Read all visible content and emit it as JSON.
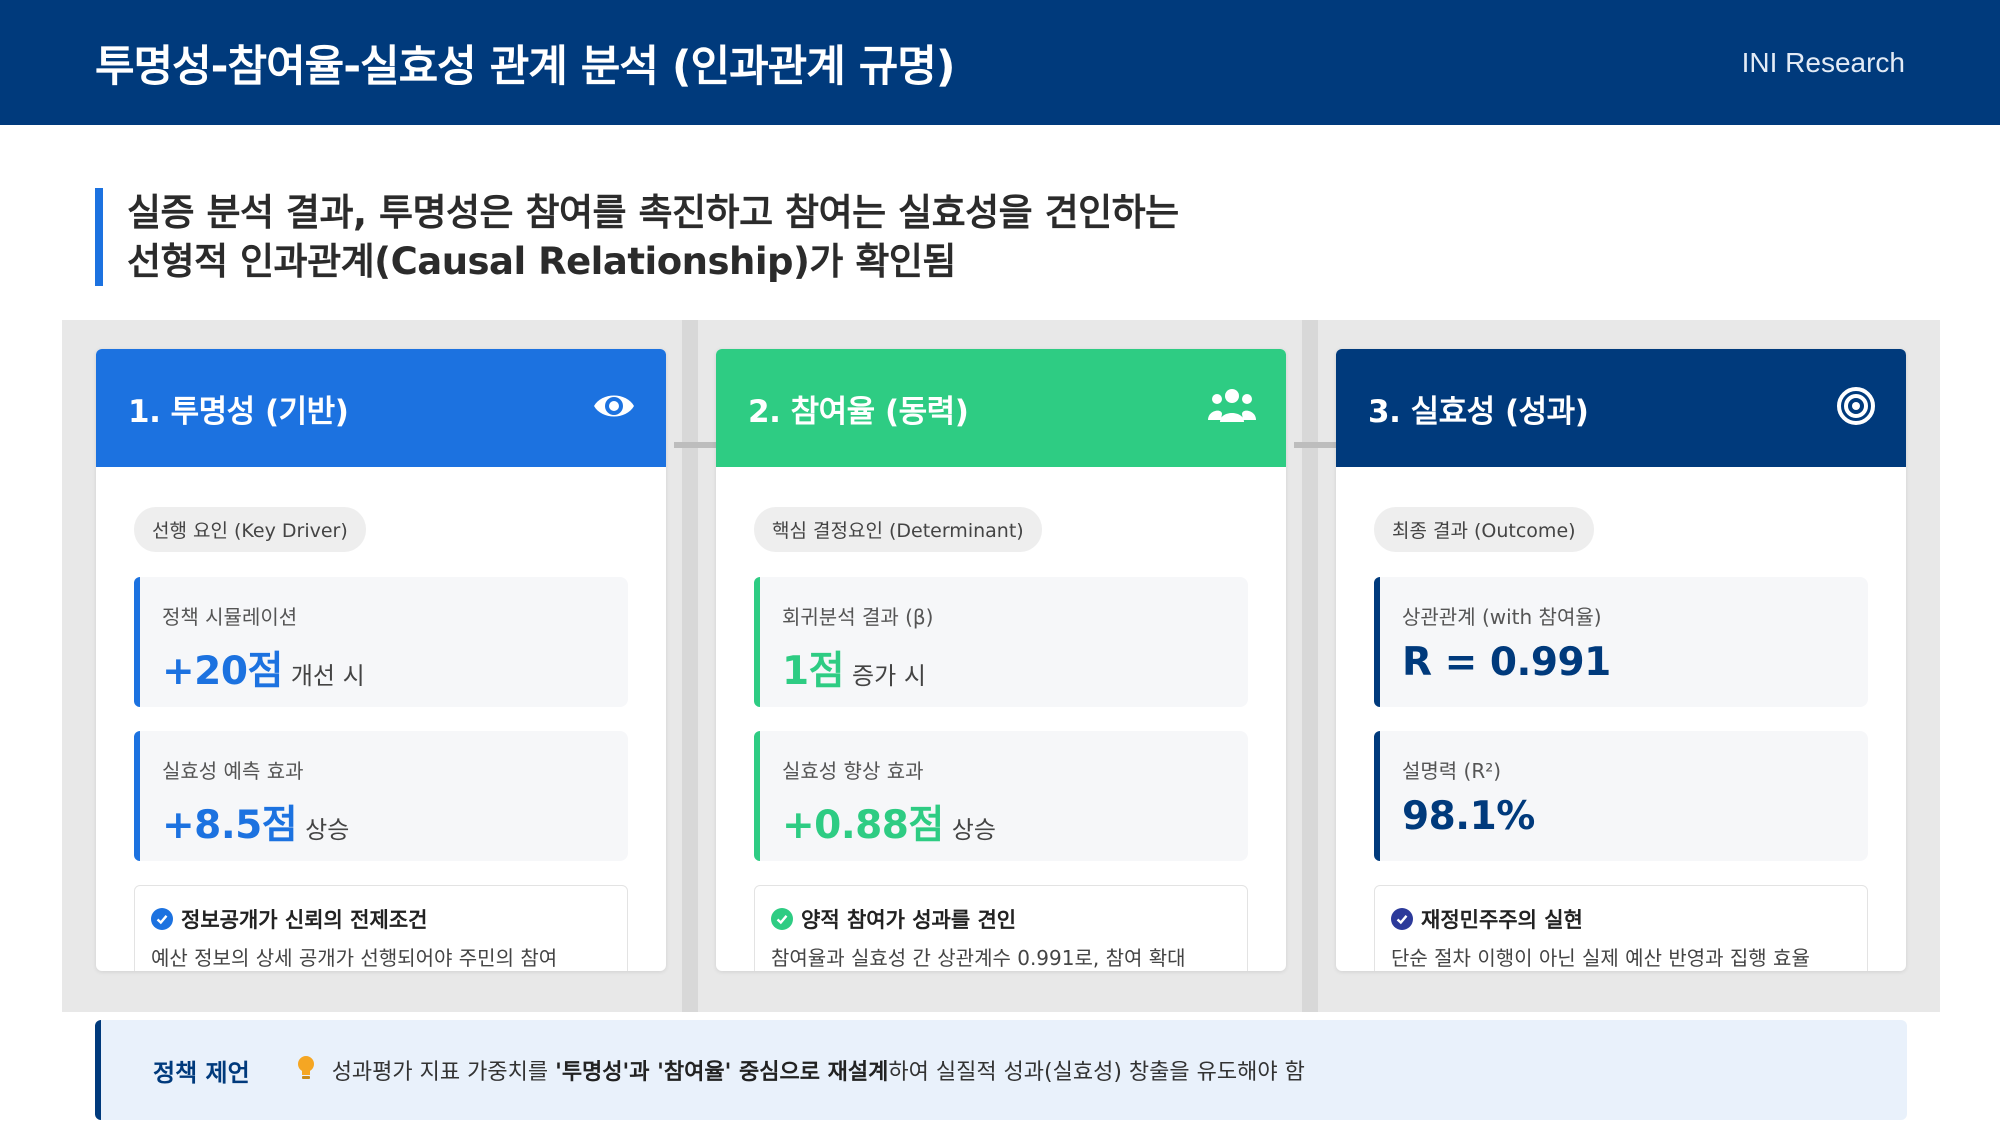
{
  "header": {
    "title": "투명성-참여율-실효성 관계 분석 (인과관계 규명)",
    "brand": "INI Research"
  },
  "headline": {
    "line1": "실증 분석 결과, 투명성은 참여를 촉진하고 참여는 실효성을 견인하는",
    "line2": "선형적 인과관계(Causal Relationship)가 확인됨"
  },
  "colors": {
    "blue": "#1c72e0",
    "green": "#2ecc83",
    "navy": "#003a7c"
  },
  "cards": [
    {
      "title": "1. 투명성 (기반)",
      "icon": "eye-icon",
      "tag": "선행 요인 (Key Driver)",
      "stat1": {
        "label": "정책 시뮬레이션",
        "value": "+20점",
        "suffix": "개선 시"
      },
      "stat2": {
        "label": "실효성 예측 효과",
        "value": "+8.5점",
        "suffix": "상승"
      },
      "note": {
        "title": "정보공개가 신뢰의 전제조건",
        "text": "예산 정보의 상세 공개가 선행되어야 주민의 참여"
      }
    },
    {
      "title": "2. 참여율 (동력)",
      "icon": "users-icon",
      "tag": "핵심 결정요인 (Determinant)",
      "stat1": {
        "label": "회귀분석 결과 (β)",
        "value": "1점",
        "suffix": "증가 시"
      },
      "stat2": {
        "label": "실효성 향상 효과",
        "value": "+0.88점",
        "suffix": "상승"
      },
      "note": {
        "title": "양적 참여가 성과를 견인",
        "text": "참여율과 실효성 간 상관계수 0.991로, 참여 확대"
      }
    },
    {
      "title": "3. 실효성 (성과)",
      "icon": "target-icon",
      "tag": "최종 결과 (Outcome)",
      "stat1": {
        "label": "상관관계 (with 참여율)",
        "value": "R = 0.991",
        "suffix": ""
      },
      "stat2": {
        "label": "설명력 (R²)",
        "value": "98.1%",
        "suffix": ""
      },
      "note": {
        "title": "재정민주주의 실현",
        "text": "단순 절차 이행이 아닌 실제 예산 반영과 집행 효율"
      }
    }
  ],
  "policy": {
    "label": "정책 제언",
    "icon": "lightbulb-icon",
    "text_a": "성과평가 지표 가중치를 ",
    "text_b": "'투명성'과 '참여율' 중심으로 재설계",
    "text_c": "하여 실질적 성과(실효성) 창출을 유도해야 함"
  }
}
